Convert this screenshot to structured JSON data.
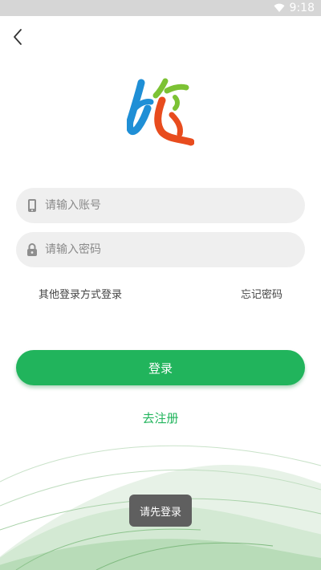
{
  "status_bar": {
    "time": "9:18",
    "wifi_icon": "wifi-icon"
  },
  "nav": {
    "back_icon": "chevron-left-icon"
  },
  "logo": {
    "icon": "travel-logo-icon",
    "colors": [
      "#1f8fd6",
      "#7cc234",
      "#e84c1e"
    ]
  },
  "form": {
    "account_placeholder": "请输入账号",
    "account_icon": "phone-icon",
    "password_placeholder": "请输入密码",
    "password_icon": "lock-icon"
  },
  "links": {
    "other_login": "其他登录方式登录",
    "forgot_password": "忘记密码"
  },
  "login_button": {
    "label": "登录",
    "color": "#21b45c"
  },
  "register_link": {
    "label": "去注册"
  },
  "toast": {
    "text": "请先登录"
  }
}
